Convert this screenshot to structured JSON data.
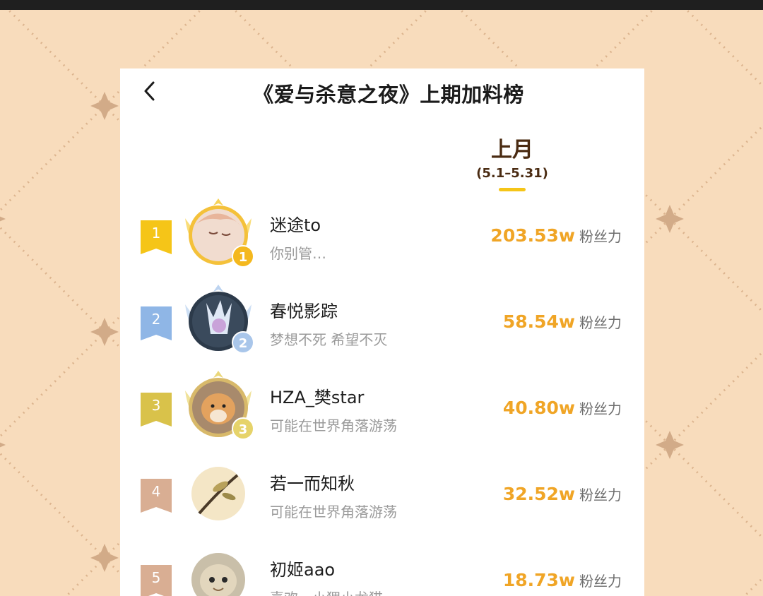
{
  "header": {
    "title": "《爱与杀意之夜》上期加料榜",
    "back_icon": "chevron-left-icon"
  },
  "period": {
    "label": "上月",
    "range": "(5.1–5.31)"
  },
  "colors": {
    "background": "#f8dcbc",
    "pattern_line": "#dcb48e",
    "accent_score": "#f0a526",
    "tab_indicator": "#f5c518",
    "rank1": "#f5c518",
    "rank2": "#8fb6e6",
    "rank3": "#d9c24a",
    "rank_other": "#d9ae93"
  },
  "rankings": [
    {
      "rank": "1",
      "name": "迷途to",
      "signature": "你别管…",
      "score": "203.53w",
      "unit": "粉丝力"
    },
    {
      "rank": "2",
      "name": "春悦影踪",
      "signature": "梦想不死   希望不灭",
      "score": "58.54w",
      "unit": "粉丝力"
    },
    {
      "rank": "3",
      "name": "HZA_樊star",
      "signature": "可能在世界角落游荡",
      "score": "40.80w",
      "unit": "粉丝力"
    },
    {
      "rank": "4",
      "name": "若一而知秋",
      "signature": "可能在世界角落游荡",
      "score": "32.52w",
      "unit": "粉丝力"
    },
    {
      "rank": "5",
      "name": "初姬aao",
      "signature": "喜欢…小狸小龙猫",
      "score": "18.73w",
      "unit": "粉丝力"
    }
  ]
}
